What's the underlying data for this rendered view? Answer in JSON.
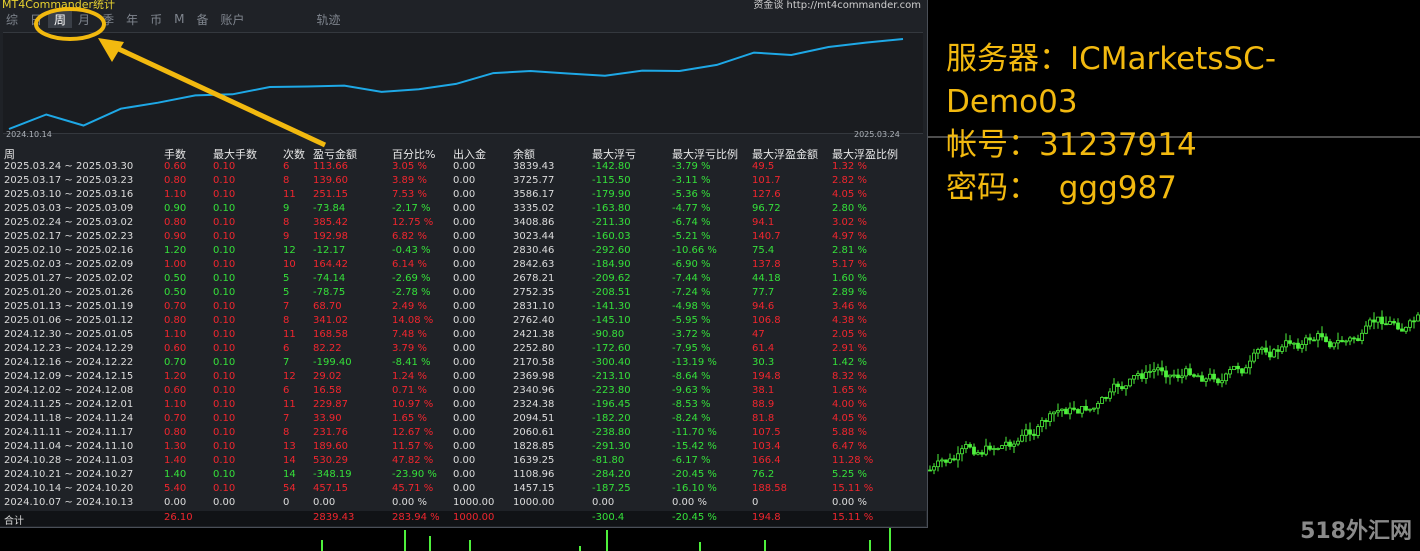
{
  "window": {
    "title": "MT4Commander统计",
    "site": "资金谈 http://mt4commander.com"
  },
  "tabs": [
    {
      "label": "综",
      "active": false
    },
    {
      "label": "日",
      "active": false
    },
    {
      "label": "周",
      "active": true
    },
    {
      "label": "月",
      "active": false
    },
    {
      "label": "季",
      "active": false
    },
    {
      "label": "年",
      "active": false
    },
    {
      "label": "币",
      "active": false
    },
    {
      "label": "M",
      "active": false
    },
    {
      "label": "备",
      "active": false
    },
    {
      "label": "账户",
      "active": false
    },
    {
      "label": "轨迹",
      "active": false
    }
  ],
  "equity": {
    "start_date": "2024.10.14",
    "end_date": "2025.03.24"
  },
  "columns": [
    "周",
    "手数",
    "最大手数",
    "次数",
    "盈亏金额",
    "百分比%",
    "出入金",
    "余额",
    "最大浮亏",
    "最大浮亏比例",
    "最大浮盈金额",
    "最大浮盈比例"
  ],
  "rows": [
    {
      "week": "2025.03.24 ~ 2025.03.30",
      "lots": "0.60",
      "max_lots": "0.10",
      "count": "6",
      "pnl": "113.66",
      "pct": "3.05 %",
      "flow": "0.00",
      "balance": "3839.43",
      "max_dd": "-142.80",
      "max_dd_pct": "-3.79 %",
      "max_fp": "49.5",
      "max_fp_pct": "1.32 %",
      "color": "red"
    },
    {
      "week": "2025.03.17 ~ 2025.03.23",
      "lots": "0.80",
      "max_lots": "0.10",
      "count": "8",
      "pnl": "139.60",
      "pct": "3.89 %",
      "flow": "0.00",
      "balance": "3725.77",
      "max_dd": "-115.50",
      "max_dd_pct": "-3.11 %",
      "max_fp": "101.7",
      "max_fp_pct": "2.82 %",
      "color": "red"
    },
    {
      "week": "2025.03.10 ~ 2025.03.16",
      "lots": "1.10",
      "max_lots": "0.10",
      "count": "11",
      "pnl": "251.15",
      "pct": "7.53 %",
      "flow": "0.00",
      "balance": "3586.17",
      "max_dd": "-179.90",
      "max_dd_pct": "-5.36 %",
      "max_fp": "127.6",
      "max_fp_pct": "4.05 %",
      "color": "red"
    },
    {
      "week": "2025.03.03 ~ 2025.03.09",
      "lots": "0.90",
      "max_lots": "0.10",
      "count": "9",
      "pnl": "-73.84",
      "pct": "-2.17 %",
      "flow": "0.00",
      "balance": "3335.02",
      "max_dd": "-163.80",
      "max_dd_pct": "-4.77 %",
      "max_fp": "96.72",
      "max_fp_pct": "2.80 %",
      "color": "green"
    },
    {
      "week": "2025.02.24 ~ 2025.03.02",
      "lots": "0.80",
      "max_lots": "0.10",
      "count": "8",
      "pnl": "385.42",
      "pct": "12.75 %",
      "flow": "0.00",
      "balance": "3408.86",
      "max_dd": "-211.30",
      "max_dd_pct": "-6.74 %",
      "max_fp": "94.1",
      "max_fp_pct": "3.02 %",
      "color": "red"
    },
    {
      "week": "2025.02.17 ~ 2025.02.23",
      "lots": "0.90",
      "max_lots": "0.10",
      "count": "9",
      "pnl": "192.98",
      "pct": "6.82 %",
      "flow": "0.00",
      "balance": "3023.44",
      "max_dd": "-160.03",
      "max_dd_pct": "-5.21 %",
      "max_fp": "140.7",
      "max_fp_pct": "4.97 %",
      "color": "red"
    },
    {
      "week": "2025.02.10 ~ 2025.02.16",
      "lots": "1.20",
      "max_lots": "0.10",
      "count": "12",
      "pnl": "-12.17",
      "pct": "-0.43 %",
      "flow": "0.00",
      "balance": "2830.46",
      "max_dd": "-292.60",
      "max_dd_pct": "-10.66 %",
      "max_fp": "75.4",
      "max_fp_pct": "2.81 %",
      "color": "green"
    },
    {
      "week": "2025.02.03 ~ 2025.02.09",
      "lots": "1.00",
      "max_lots": "0.10",
      "count": "10",
      "pnl": "164.42",
      "pct": "6.14 %",
      "flow": "0.00",
      "balance": "2842.63",
      "max_dd": "-184.90",
      "max_dd_pct": "-6.90 %",
      "max_fp": "137.8",
      "max_fp_pct": "5.17 %",
      "color": "red"
    },
    {
      "week": "2025.01.27 ~ 2025.02.02",
      "lots": "0.50",
      "max_lots": "0.10",
      "count": "5",
      "pnl": "-74.14",
      "pct": "-2.69 %",
      "flow": "0.00",
      "balance": "2678.21",
      "max_dd": "-209.62",
      "max_dd_pct": "-7.44 %",
      "max_fp": "44.18",
      "max_fp_pct": "1.60 %",
      "color": "green"
    },
    {
      "week": "2025.01.20 ~ 2025.01.26",
      "lots": "0.50",
      "max_lots": "0.10",
      "count": "5",
      "pnl": "-78.75",
      "pct": "-2.78 %",
      "flow": "0.00",
      "balance": "2752.35",
      "max_dd": "-208.51",
      "max_dd_pct": "-7.24 %",
      "max_fp": "77.7",
      "max_fp_pct": "2.89 %",
      "color": "green"
    },
    {
      "week": "2025.01.13 ~ 2025.01.19",
      "lots": "0.70",
      "max_lots": "0.10",
      "count": "7",
      "pnl": "68.70",
      "pct": "2.49 %",
      "flow": "0.00",
      "balance": "2831.10",
      "max_dd": "-141.30",
      "max_dd_pct": "-4.98 %",
      "max_fp": "94.6",
      "max_fp_pct": "3.46 %",
      "color": "red"
    },
    {
      "week": "2025.01.06 ~ 2025.01.12",
      "lots": "0.80",
      "max_lots": "0.10",
      "count": "8",
      "pnl": "341.02",
      "pct": "14.08 %",
      "flow": "0.00",
      "balance": "2762.40",
      "max_dd": "-145.10",
      "max_dd_pct": "-5.95 %",
      "max_fp": "106.8",
      "max_fp_pct": "4.38 %",
      "color": "red"
    },
    {
      "week": "2024.12.30 ~ 2025.01.05",
      "lots": "1.10",
      "max_lots": "0.10",
      "count": "11",
      "pnl": "168.58",
      "pct": "7.48 %",
      "flow": "0.00",
      "balance": "2421.38",
      "max_dd": "-90.80",
      "max_dd_pct": "-3.72 %",
      "max_fp": "47",
      "max_fp_pct": "2.05 %",
      "color": "red"
    },
    {
      "week": "2024.12.23 ~ 2024.12.29",
      "lots": "0.60",
      "max_lots": "0.10",
      "count": "6",
      "pnl": "82.22",
      "pct": "3.79 %",
      "flow": "0.00",
      "balance": "2252.80",
      "max_dd": "-172.60",
      "max_dd_pct": "-7.95 %",
      "max_fp": "61.4",
      "max_fp_pct": "2.91 %",
      "color": "red"
    },
    {
      "week": "2024.12.16 ~ 2024.12.22",
      "lots": "0.70",
      "max_lots": "0.10",
      "count": "7",
      "pnl": "-199.40",
      "pct": "-8.41 %",
      "flow": "0.00",
      "balance": "2170.58",
      "max_dd": "-300.40",
      "max_dd_pct": "-13.19 %",
      "max_fp": "30.3",
      "max_fp_pct": "1.42 %",
      "color": "green"
    },
    {
      "week": "2024.12.09 ~ 2024.12.15",
      "lots": "1.20",
      "max_lots": "0.10",
      "count": "12",
      "pnl": "29.02",
      "pct": "1.24 %",
      "flow": "0.00",
      "balance": "2369.98",
      "max_dd": "-213.10",
      "max_dd_pct": "-8.64 %",
      "max_fp": "194.8",
      "max_fp_pct": "8.32 %",
      "color": "red"
    },
    {
      "week": "2024.12.02 ~ 2024.12.08",
      "lots": "0.60",
      "max_lots": "0.10",
      "count": "6",
      "pnl": "16.58",
      "pct": "0.71 %",
      "flow": "0.00",
      "balance": "2340.96",
      "max_dd": "-223.80",
      "max_dd_pct": "-9.63 %",
      "max_fp": "38.1",
      "max_fp_pct": "1.65 %",
      "color": "red"
    },
    {
      "week": "2024.11.25 ~ 2024.12.01",
      "lots": "1.10",
      "max_lots": "0.10",
      "count": "11",
      "pnl": "229.87",
      "pct": "10.97 %",
      "flow": "0.00",
      "balance": "2324.38",
      "max_dd": "-196.45",
      "max_dd_pct": "-8.53 %",
      "max_fp": "88.9",
      "max_fp_pct": "4.00 %",
      "color": "red"
    },
    {
      "week": "2024.11.18 ~ 2024.11.24",
      "lots": "0.70",
      "max_lots": "0.10",
      "count": "7",
      "pnl": "33.90",
      "pct": "1.65 %",
      "flow": "0.00",
      "balance": "2094.51",
      "max_dd": "-182.20",
      "max_dd_pct": "-8.24 %",
      "max_fp": "81.8",
      "max_fp_pct": "4.05 %",
      "color": "red"
    },
    {
      "week": "2024.11.11 ~ 2024.11.17",
      "lots": "0.80",
      "max_lots": "0.10",
      "count": "8",
      "pnl": "231.76",
      "pct": "12.67 %",
      "flow": "0.00",
      "balance": "2060.61",
      "max_dd": "-238.80",
      "max_dd_pct": "-11.70 %",
      "max_fp": "107.5",
      "max_fp_pct": "5.88 %",
      "color": "red"
    },
    {
      "week": "2024.11.04 ~ 2024.11.10",
      "lots": "1.30",
      "max_lots": "0.10",
      "count": "13",
      "pnl": "189.60",
      "pct": "11.57 %",
      "flow": "0.00",
      "balance": "1828.85",
      "max_dd": "-291.30",
      "max_dd_pct": "-15.42 %",
      "max_fp": "103.4",
      "max_fp_pct": "6.47 %",
      "color": "red"
    },
    {
      "week": "2024.10.28 ~ 2024.11.03",
      "lots": "1.40",
      "max_lots": "0.10",
      "count": "14",
      "pnl": "530.29",
      "pct": "47.82 %",
      "flow": "0.00",
      "balance": "1639.25",
      "max_dd": "-81.80",
      "max_dd_pct": "-6.17 %",
      "max_fp": "166.4",
      "max_fp_pct": "11.28 %",
      "color": "red"
    },
    {
      "week": "2024.10.21 ~ 2024.10.27",
      "lots": "1.40",
      "max_lots": "0.10",
      "count": "14",
      "pnl": "-348.19",
      "pct": "-23.90 %",
      "flow": "0.00",
      "balance": "1108.96",
      "max_dd": "-284.20",
      "max_dd_pct": "-20.45 %",
      "max_fp": "76.2",
      "max_fp_pct": "5.25 %",
      "color": "green"
    },
    {
      "week": "2024.10.14 ~ 2024.10.20",
      "lots": "5.40",
      "max_lots": "0.10",
      "count": "54",
      "pnl": "457.15",
      "pct": "45.71 %",
      "flow": "0.00",
      "balance": "1457.15",
      "max_dd": "-187.25",
      "max_dd_pct": "-16.10 %",
      "max_fp": "188.58",
      "max_fp_pct": "15.11 %",
      "color": "red"
    },
    {
      "week": "2024.10.07 ~ 2024.10.13",
      "lots": "0.00",
      "max_lots": "0.00",
      "count": "0",
      "pnl": "0.00",
      "pct": "0.00 %",
      "flow": "1000.00",
      "balance": "1000.00",
      "max_dd": "0.00",
      "max_dd_pct": "0.00 %",
      "max_fp": "0",
      "max_fp_pct": "0.00 %",
      "color": "white"
    }
  ],
  "total": {
    "label": "合计",
    "lots": "26.10",
    "pnl": "2839.43",
    "pct": "283.94 %",
    "flow": "1000.00",
    "max_dd": "-300.4",
    "max_dd_pct": "-20.45 %",
    "max_fp": "194.8",
    "max_fp_pct": "15.11 %"
  },
  "account": {
    "server": "服务器：ICMarketsSC-\nDemo03",
    "account": "帐号：31237914",
    "password": "密码：  ggg987"
  },
  "watermark": "518外汇网",
  "colors": {
    "profit": "#f0262e",
    "loss": "#35e03a",
    "equity_line": "#1ea8e6",
    "accent": "#f2b90f",
    "candle": "#4ef03c"
  }
}
